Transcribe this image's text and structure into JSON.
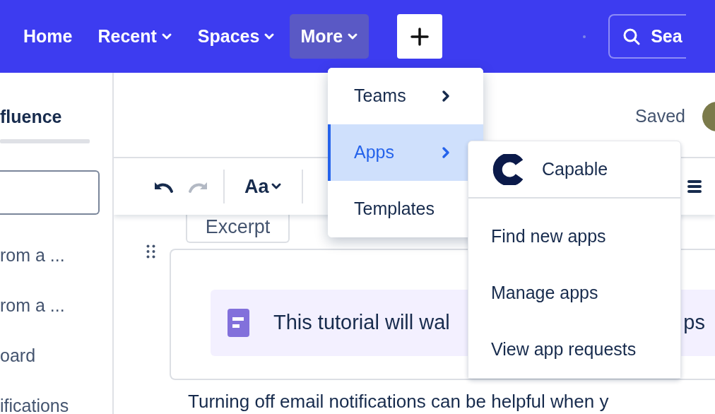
{
  "nav": {
    "items": [
      {
        "label": "Home",
        "has_caret": false,
        "selected": false
      },
      {
        "label": "Recent",
        "has_caret": true,
        "selected": false
      },
      {
        "label": "Spaces",
        "has_caret": true,
        "selected": false
      },
      {
        "label": "More",
        "has_caret": true,
        "selected": true
      }
    ],
    "search": {
      "placeholder": "Sea"
    }
  },
  "sidebar": {
    "title": "fluence",
    "items": [
      "rom a ...",
      "rom a ...",
      "oard",
      "ifications"
    ]
  },
  "header": {
    "status": "Saved"
  },
  "toolbar": {
    "undo_disabled": false,
    "redo_disabled": true,
    "text_style": "Aa"
  },
  "content": {
    "excerpt_label": "Excerpt",
    "panel_texts": [
      "This tutorial will wal",
      "ps"
    ],
    "paragraph": "Turning off email notifications can be helpful when y"
  },
  "more_menu": {
    "items": [
      {
        "label": "Teams",
        "selected": false,
        "has_submenu": true
      },
      {
        "label": "Apps",
        "selected": true,
        "has_submenu": true
      },
      {
        "label": "Templates",
        "selected": false,
        "has_submenu": false
      }
    ]
  },
  "apps_submenu": {
    "app_name": "Capable",
    "items": [
      "Find new apps",
      "Manage apps",
      "View app requests"
    ]
  }
}
